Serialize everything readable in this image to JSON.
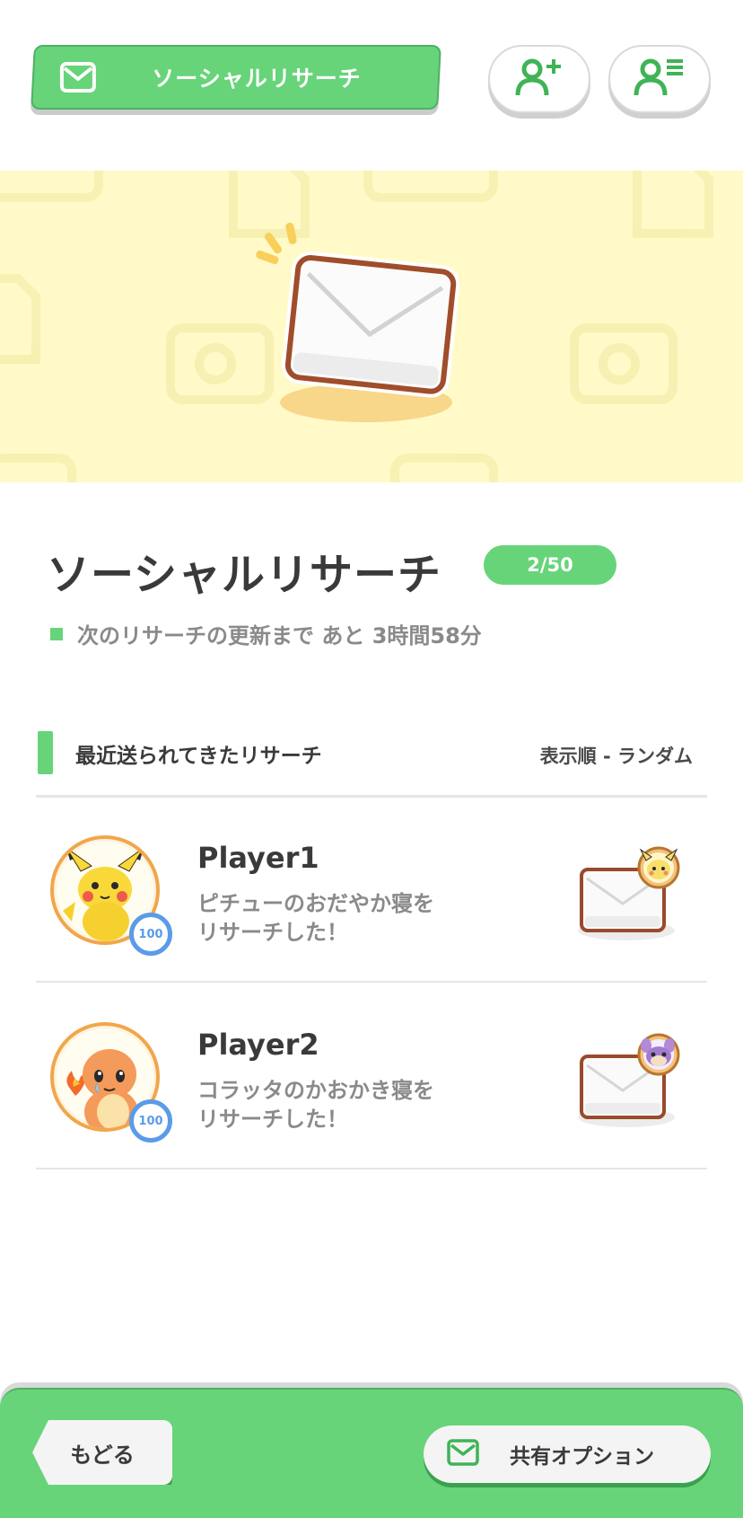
{
  "header": {
    "tab_label": "ソーシャルリサーチ"
  },
  "main": {
    "title": "ソーシャルリサーチ",
    "count_badge": "2/50",
    "update_text": "次のリサーチの更新まで あと 3時間58分"
  },
  "section": {
    "title": "最近送られてきたリサーチ",
    "sort_label": "表示順 - ランダム"
  },
  "research_list": [
    {
      "player": "Player1",
      "line1": "ピチューのおだやか寝を",
      "line2": "リサーチした！",
      "level": "100",
      "avatar_pokemon": "pikachu-icon",
      "stamp_pokemon": "pichu-icon"
    },
    {
      "player": "Player2",
      "line1": "コラッタのかおかき寝を",
      "line2": "リサーチした！",
      "level": "100",
      "avatar_pokemon": "charmander-icon",
      "stamp_pokemon": "rattata-icon"
    }
  ],
  "footer": {
    "back_label": "もどる",
    "share_label": "共有オプション"
  },
  "colors": {
    "accent_green": "#67d47a",
    "banner_yellow": "#fffac8",
    "level_blue": "#5b9be8",
    "avatar_ring": "#f1a64b",
    "letter_border": "#9a4a2a"
  }
}
